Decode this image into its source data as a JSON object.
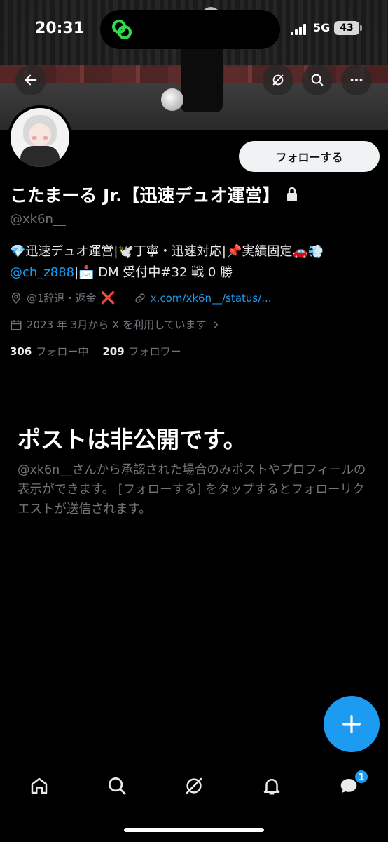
{
  "status_bar": {
    "time": "20:31",
    "network": "5G",
    "battery": "43"
  },
  "header": {
    "back_icon": "arrow-left-icon",
    "grok_icon": "slash-circle-icon",
    "search_icon": "search-icon",
    "more_icon": "more-horizontal-icon"
  },
  "profile": {
    "follow_label": "フォローする",
    "display_name": "こたまーる Jr.【迅速デュオ運営】",
    "handle": "@xk6n__",
    "bio_line1": "💎迅速デュオ運営|🕊️丁寧・迅速対応|📌実績固定🚗💨",
    "bio_mention": "@ch_z888",
    "bio_line2_rest": "|📩 DM 受付中#32 戦 0 勝",
    "location": "@1辞退・返金",
    "location_mark": "❌",
    "website": "x.com/xk6n__/status/...",
    "joined": "2023 年 3月から X を利用しています",
    "following_count": "306",
    "following_label": "フォロー中",
    "followers_count": "209",
    "followers_label": "フォロワー"
  },
  "private_notice": {
    "title": "ポストは非公開です。",
    "body": "@xk6n__さんから承認された場合のみポストやプロフィールの表示ができます。 [フォローする] をタップするとフォローリクエストが送信されます。"
  },
  "tabbar": {
    "messages_badge": "1"
  },
  "colors": {
    "accent": "#1d9bf0",
    "muted_text": "#71767b",
    "background": "#000000"
  }
}
